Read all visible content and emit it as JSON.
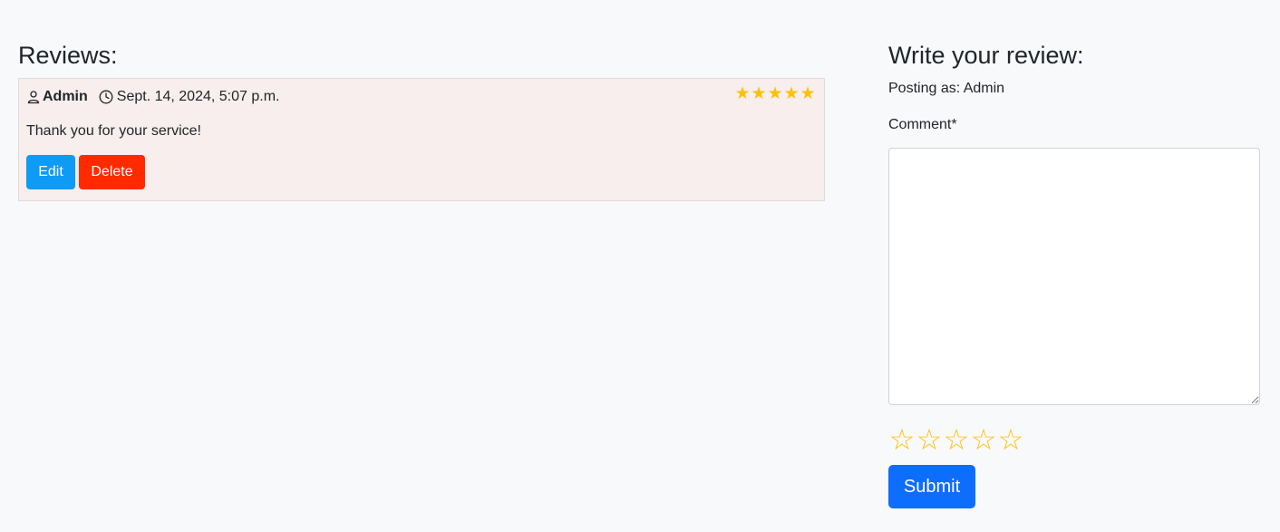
{
  "reviews": {
    "heading": "Reviews:",
    "items": [
      {
        "author": "Admin",
        "date": "Sept. 14, 2024, 5:07 p.m.",
        "rating": 5,
        "stars": [
          "★",
          "★",
          "★",
          "★",
          "★"
        ],
        "text": "Thank you for your service!",
        "edit_label": "Edit",
        "delete_label": "Delete"
      }
    ]
  },
  "form": {
    "heading": "Write your review:",
    "posting_as": "Posting as: Admin",
    "comment_label": "Comment*",
    "comment_value": "",
    "rating_stars": [
      "☆",
      "☆",
      "☆",
      "☆",
      "☆"
    ],
    "submit_label": "Submit"
  },
  "colors": {
    "background": "#f8f9fb",
    "card_background": "#f7eeed",
    "star": "#ffc107",
    "edit_button": "#0d9bf5",
    "delete_button": "#ff2a00",
    "submit_button": "#0d6efd"
  }
}
